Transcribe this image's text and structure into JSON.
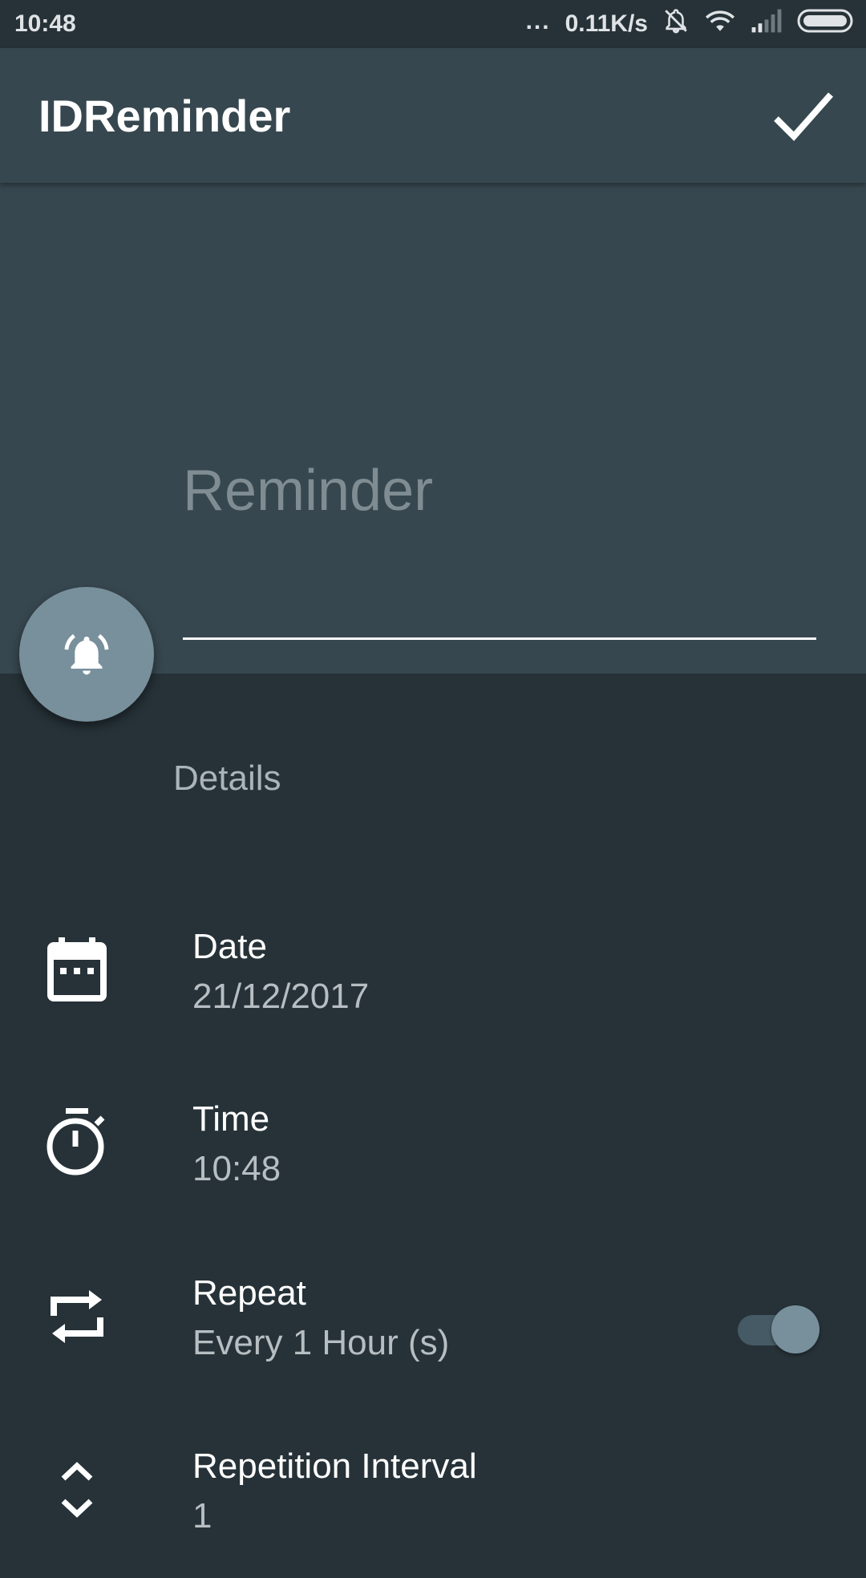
{
  "status_bar": {
    "time": "10:48",
    "dots": "...",
    "network_speed": "0.11K/s",
    "icons": [
      "bell-off-icon",
      "wifi-icon",
      "signal-icon",
      "battery-icon"
    ]
  },
  "toolbar": {
    "title": "IDReminder",
    "confirm_icon": "check-icon"
  },
  "reminder": {
    "placeholder": "Reminder",
    "value": ""
  },
  "fab": {
    "icon": "alarm-bell-icon"
  },
  "details": {
    "label": "Details",
    "rows": [
      {
        "title": "Date",
        "value": "21/12/2017",
        "icon": "calendar-icon"
      },
      {
        "title": "Time",
        "value": "10:48",
        "icon": "timer-icon"
      },
      {
        "title": "Repeat",
        "value": "Every 1 Hour (s)",
        "icon": "repeat-icon",
        "toggle_on": true
      },
      {
        "title": "Repetition Interval",
        "value": "1",
        "icon": "unfold-icon"
      }
    ]
  },
  "colors": {
    "primary": "#37474f",
    "primary_dark": "#263238",
    "accent": "#78909c"
  }
}
